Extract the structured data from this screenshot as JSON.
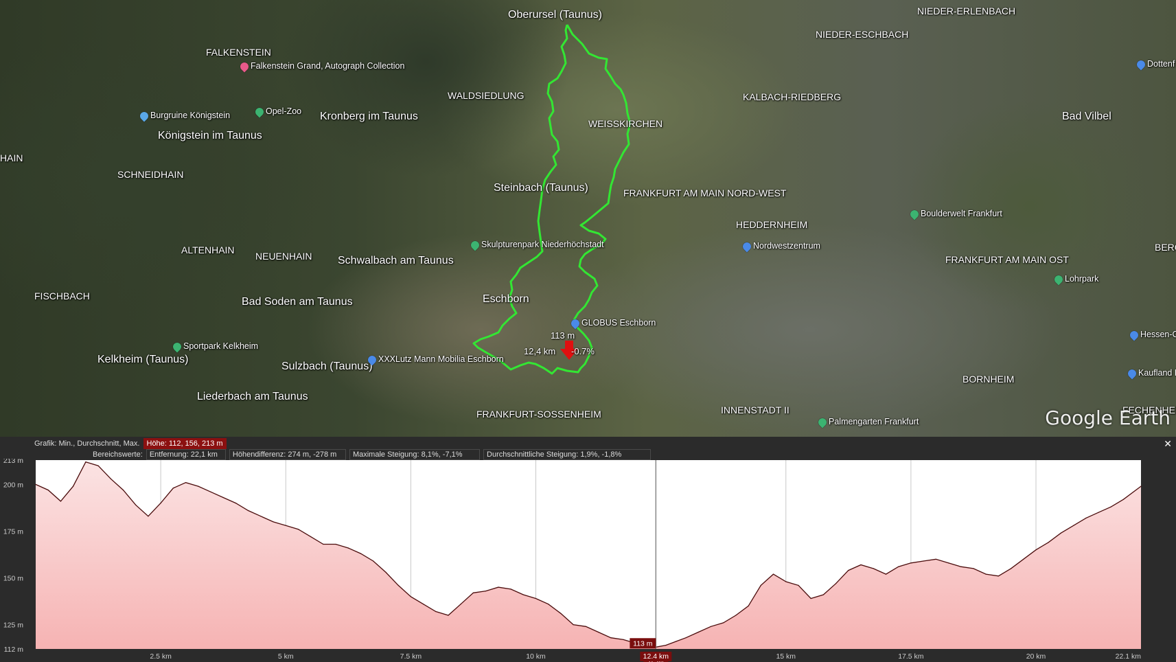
{
  "map": {
    "labels_big": [
      {
        "text": "Oberursel (Taunus)"
      },
      {
        "text": "Kronberg im Taunus"
      },
      {
        "text": "Königstein im Taunus"
      },
      {
        "text": "Steinbach (Taunus)"
      },
      {
        "text": "Schwalbach am Taunus"
      },
      {
        "text": "Eschborn"
      },
      {
        "text": "Bad Soden am Taunus"
      },
      {
        "text": "Kelkheim (Taunus)"
      },
      {
        "text": "Sulzbach (Taunus)"
      },
      {
        "text": "Liederbach am Taunus"
      },
      {
        "text": "Bad Vilbel"
      }
    ],
    "labels_caps": [
      {
        "text": "FALKENSTEIN"
      },
      {
        "text": "WALDSIEDLUNG"
      },
      {
        "text": "WEISSKIRCHEN"
      },
      {
        "text": "NIEDER-ESCHBACH"
      },
      {
        "text": "NIEDER-ERLENBACH"
      },
      {
        "text": "KALBACH-RIEDBERG"
      },
      {
        "text": "SCHNEIDHAIN"
      },
      {
        "text": "HAIN"
      },
      {
        "text": "FRANKFURT AM MAIN NORD-WEST"
      },
      {
        "text": "HEDDERNHEIM"
      },
      {
        "text": "ALTENHAIN"
      },
      {
        "text": "NEUENHAIN"
      },
      {
        "text": "FISCHBACH"
      },
      {
        "text": "FRANKFURT AM MAIN OST"
      },
      {
        "text": "BERGEN"
      },
      {
        "text": "INNENSTADT II"
      },
      {
        "text": "BORNHEIM"
      },
      {
        "text": "FRANKFURT-SOSSENHEIM"
      },
      {
        "text": "FECHENHEI"
      }
    ],
    "pois": [
      {
        "text": "Falkenstein Grand, Autograph Collection",
        "color": "#e85a8a"
      },
      {
        "text": "Burgruine Königstein",
        "color": "#5aa8e8"
      },
      {
        "text": "Opel-Zoo",
        "color": "#3cb371"
      },
      {
        "text": "Skulpturenpark Niederhöchstadt",
        "color": "#3cb371"
      },
      {
        "text": "GLOBUS Eschborn",
        "color": "#4a8ae8"
      },
      {
        "text": "XXXLutz Mann Mobilia Eschborn",
        "color": "#4a8ae8"
      },
      {
        "text": "Sportpark Kelkheim",
        "color": "#3cb371"
      },
      {
        "text": "Boulderwelt Frankfurt",
        "color": "#3cb371"
      },
      {
        "text": "Nordwestzentrum",
        "color": "#4a8ae8"
      },
      {
        "text": "Lohrpark",
        "color": "#3cb371"
      },
      {
        "text": "Hessen-C",
        "color": "#4a8ae8"
      },
      {
        "text": "Kaufland H",
        "color": "#4a8ae8"
      },
      {
        "text": "Palmengarten Frankfurt",
        "color": "#3cb371"
      },
      {
        "text": "Dottenf",
        "color": "#4a8ae8"
      }
    ],
    "marker": {
      "altitude": "113 m",
      "distance": "12,4 km",
      "slope": "-0.7%"
    },
    "watermark": "Google Earth",
    "route_color": "#33e633"
  },
  "panel": {
    "stats_label": "Grafik: Min., Durchschnitt, Max.",
    "height_stats": "Höhe: 112, 156, 213 m",
    "range_label": "Bereichswerte:",
    "distance": "Entfernung: 22,1 km",
    "height_diff": "Höhendifferenz: 274 m, -278 m",
    "max_slope": "Maximale Steigung: 8,1%, -7,1%",
    "avg_slope": "Durchschnittliche Steigung: 1,9%, -1,8%",
    "close_label": "✕"
  },
  "chart_data": {
    "type": "area",
    "title": "",
    "xlabel": "",
    "ylabel": "",
    "xlim": [
      0,
      22.1
    ],
    "ylim": [
      112,
      213
    ],
    "x_ticks": [
      "2.5 km",
      "5 km",
      "7.5 km",
      "10 km",
      "12.4 km",
      "15 km",
      "17.5 km",
      "20 km",
      "22.1 km"
    ],
    "x_tick_values": [
      2.5,
      5,
      7.5,
      10,
      12.4,
      15,
      17.5,
      20,
      22.1
    ],
    "y_ticks": [
      "213 m",
      "200 m",
      "175 m",
      "150 m",
      "125 m",
      "112 m"
    ],
    "y_tick_values": [
      213,
      200,
      175,
      150,
      125,
      112
    ],
    "cursor": {
      "x": 12.4,
      "x_label": "12.4 km",
      "value_label": "113 m",
      "slope_label": "-0.7%"
    },
    "line_color": "#4a0c0c",
    "fill_color": "#f6b3b3",
    "series": [
      {
        "x": [
          0,
          0.25,
          0.5,
          0.75,
          1.0,
          1.25,
          1.5,
          1.75,
          2.0,
          2.25,
          2.5,
          2.75,
          3.0,
          3.25,
          3.5,
          3.75,
          4.0,
          4.25,
          4.5,
          4.75,
          5.0,
          5.25,
          5.5,
          5.75,
          6.0,
          6.25,
          6.5,
          6.75,
          7.0,
          7.25,
          7.5,
          7.75,
          8.0,
          8.25,
          8.5,
          8.75,
          9.0,
          9.25,
          9.5,
          9.75,
          10.0,
          10.25,
          10.5,
          10.75,
          11.0,
          11.25,
          11.5,
          11.75,
          12.0,
          12.25,
          12.4,
          12.6,
          12.8,
          13.0,
          13.25,
          13.5,
          13.75,
          14.0,
          14.25,
          14.5,
          14.75,
          15.0,
          15.25,
          15.5,
          15.75,
          16.0,
          16.25,
          16.5,
          16.75,
          17.0,
          17.25,
          17.5,
          17.75,
          18.0,
          18.25,
          18.5,
          18.75,
          19.0,
          19.25,
          19.5,
          19.75,
          20.0,
          20.25,
          20.5,
          20.75,
          21.0,
          21.25,
          21.5,
          21.75,
          22.1
        ],
        "y": [
          200,
          197,
          191,
          199,
          212,
          210,
          203,
          197,
          189,
          183,
          190,
          198,
          201,
          199,
          196,
          193,
          190,
          186,
          183,
          180,
          178,
          176,
          172,
          168,
          168,
          166,
          163,
          159,
          153,
          146,
          140,
          136,
          132,
          130,
          136,
          142,
          143,
          145,
          144,
          141,
          139,
          136,
          131,
          125,
          124,
          121,
          118,
          117,
          115,
          114,
          113,
          114,
          116,
          118,
          121,
          124,
          126,
          130,
          135,
          146,
          152,
          148,
          146,
          139,
          141,
          147,
          154,
          157,
          155,
          152,
          156,
          158,
          159,
          160,
          158,
          156,
          155,
          152,
          151,
          155,
          160,
          165,
          169,
          174,
          178,
          182,
          185,
          188,
          192,
          199
        ]
      }
    ]
  }
}
